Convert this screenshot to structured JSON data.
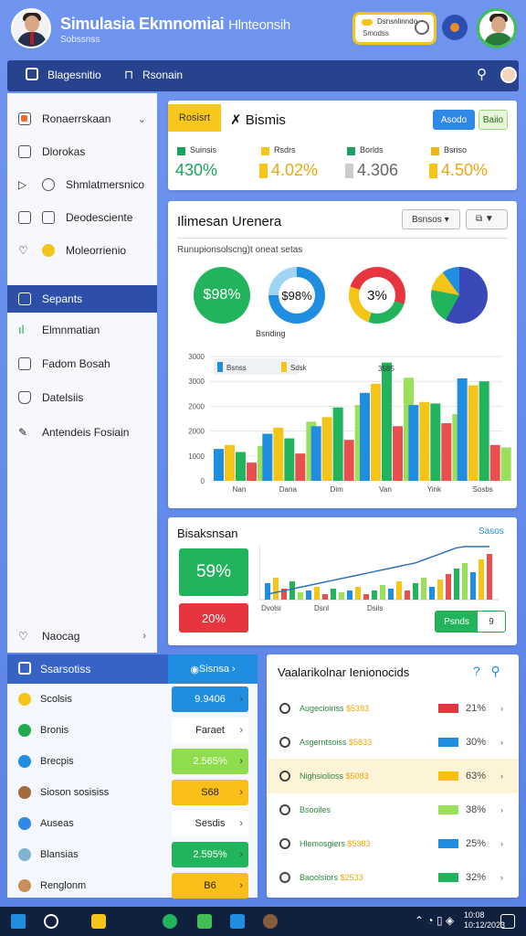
{
  "header": {
    "title": "Simulasia Ekmnomiai",
    "title_light": "Hlnteonsih",
    "subtitle": "Sobssnss",
    "status_pill_line1": "Dsnsnlinndo",
    "status_pill_line2": "Smodss"
  },
  "navbar": {
    "brand": "Blagesnitio",
    "menu": "Rsonain"
  },
  "sidebar": {
    "items": [
      {
        "label": "Ronaerrskaan"
      },
      {
        "label": "Dlorokas"
      },
      {
        "label": "Shmlatmersnico"
      },
      {
        "label": "Deodesciente"
      },
      {
        "label": "Moleorrienio"
      },
      {
        "label": "Sepants"
      },
      {
        "label": "Elmnmatian"
      },
      {
        "label": "Fadom Bosah"
      },
      {
        "label": "Datelsiis"
      },
      {
        "label": "Antendeis Fosiain"
      }
    ],
    "bottom_item": "Naocag"
  },
  "kpi_card": {
    "badge": "Rosisrt",
    "title": "Bismis",
    "btn_primary": "Asodo",
    "btn_secondary": "Baiio",
    "kpis": [
      {
        "label": "Suinsis",
        "value": "430%",
        "color": "#1aa35b"
      },
      {
        "label": "Rsdrs",
        "value": "4.02%",
        "color": "#f4c518"
      },
      {
        "label": "Borlds",
        "value": "4.306",
        "color": "#18a15f"
      },
      {
        "label": "Bsriso",
        "value": "4.50%",
        "color": "#f4b514"
      }
    ]
  },
  "chart_card": {
    "title": "Ilimesan Urenera",
    "dropdown": "Bsnsos",
    "dropdown2": "▼",
    "subtitle": "Runupionsolscng)t oneat setas",
    "donuts": [
      {
        "value": "$98%"
      },
      {
        "value": "$98%"
      },
      {
        "value": "3%"
      },
      {
        "value": ""
      }
    ],
    "donut_caption": "Bsnding"
  },
  "chart_data": {
    "type": "bar",
    "categories": [
      "Nan",
      "Dana",
      "Dim",
      "Van",
      "Yink",
      "Sosbs"
    ],
    "series": [
      {
        "name": "Bsnss",
        "color": "#1f8ee0",
        "values": [
          1050,
          1550,
          1800,
          2900,
          2500,
          3380
        ]
      },
      {
        "name": "Sdsk",
        "color": "#f4c518",
        "values": [
          1180,
          1750,
          2100,
          3200,
          2600,
          3150
        ]
      },
      {
        "name": "",
        "color": "#22b35d",
        "values": [
          950,
          1400,
          2420,
          3900,
          2550,
          3280
        ]
      },
      {
        "name": "",
        "color": "#e94f4f",
        "values": [
          600,
          900,
          1350,
          1800,
          1900,
          1180
        ]
      },
      {
        "name": "",
        "color": "#9be05a",
        "values": [
          1150,
          1950,
          2500,
          3400,
          2200,
          1100
        ]
      }
    ],
    "y_ticks": [
      "3000",
      "3000",
      "2000",
      "2000",
      "1000",
      "0"
    ],
    "annotation": "3585",
    "ylim": [
      0,
      4100
    ],
    "grid": true,
    "legend": "top-left"
  },
  "break_card": {
    "title": "Bisaksnsan",
    "link": "Sasos",
    "big_green": "59%",
    "big_red": "20%",
    "mini_labels": [
      "Dvolsi",
      "Dsnl",
      "Dsiis"
    ],
    "btn_a": "Psnds",
    "btn_b": "9"
  },
  "left_list": {
    "header": "Ssarsotiss",
    "header_right": "Sisnsa",
    "items": [
      {
        "label": "Scolsis",
        "color": "#f4c518"
      },
      {
        "label": "Bronis",
        "color": "#22a94b"
      },
      {
        "label": "Brecpis",
        "color": "#1f8ee0"
      },
      {
        "label": "Sioson sosisiss",
        "color": "#a66b3c"
      },
      {
        "label": "Auseas",
        "color": "#2f89e6"
      },
      {
        "label": "Blansias",
        "color": "#7fb3d4"
      },
      {
        "label": "Renglonm",
        "color": "#c98f5a"
      }
    ],
    "values": [
      {
        "text": "9.9406",
        "bg": "#1f8ee0",
        "fg": "#fff"
      },
      {
        "text": "Faraet",
        "bg": "#fff",
        "fg": "#222"
      },
      {
        "text": "2.565%",
        "bg": "#8fdc4c",
        "fg": "#fff"
      },
      {
        "text": "S68",
        "bg": "#f9be17",
        "fg": "#222"
      },
      {
        "text": "Sesdis",
        "bg": "#fff",
        "fg": "#222"
      },
      {
        "text": "2.595%",
        "bg": "#22b35d",
        "fg": "#fff"
      },
      {
        "text": "B6",
        "bg": "#f9be17",
        "fg": "#222"
      }
    ]
  },
  "value_list": {
    "title": "Vaalarikolnar Ienionocids",
    "rows": [
      {
        "text": "Augecioiriss",
        "num": "$5383",
        "pct": "21%",
        "bar": "#e7353f",
        "hl": false
      },
      {
        "text": "Asgerntsoiss",
        "num": "$5833",
        "pct": "30%",
        "bar": "#1f8ee0",
        "hl": false
      },
      {
        "text": "Nighsiolioss",
        "num": "$5083",
        "pct": "63%",
        "bar": "#f9be17",
        "hl": true
      },
      {
        "text": "Bsooiles",
        "num": "",
        "pct": "38%",
        "bar": "#9be05a",
        "hl": false
      },
      {
        "text": "Hlemosgiers",
        "num": "$5383",
        "pct": "25%",
        "bar": "#1f8ee0",
        "hl": false
      },
      {
        "text": "Baoolsiors",
        "num": "$2533",
        "pct": "32%",
        "bar": "#22b35d",
        "hl": false
      }
    ]
  },
  "taskbar": {
    "clock_line1": "10:08",
    "clock_line2": "10:12/2023"
  }
}
